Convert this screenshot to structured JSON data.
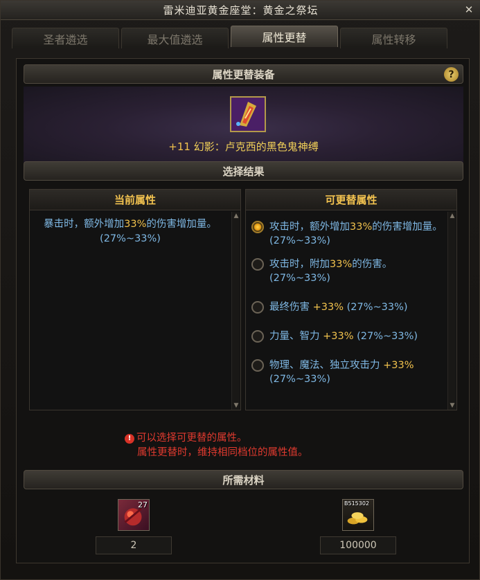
{
  "window": {
    "title": "雷米迪亚黄金座堂：黄金之祭坛",
    "close_glyph": "✕"
  },
  "tabs": [
    {
      "label": "圣者遴选"
    },
    {
      "label": "最大值遴选"
    },
    {
      "label": "属性更替"
    },
    {
      "label": "属性转移"
    }
  ],
  "equip_section": {
    "header": "属性更替装备",
    "help_glyph": "?",
    "item_plus": "+11",
    "item_name": "幻影：卢克西的黑色鬼神缚"
  },
  "result_section": {
    "header": "选择结果",
    "current": {
      "head": "当前属性",
      "text_before": "暴击时，额外增加",
      "text_num": "33%",
      "text_after": "的伤害增加量。(27%~33%)"
    },
    "options_head": "可更替属性",
    "options": [
      {
        "before": "攻击时，额外增加",
        "num": "33%",
        "after": "的伤害增加量。(27%~33%)",
        "checked": true
      },
      {
        "before": "攻击时，附加",
        "num": "33%",
        "after": "的伤害。(27%~33%)",
        "checked": false
      },
      {
        "before": "最终伤害 ",
        "num": "+33%",
        "after": " (27%~33%)",
        "checked": false
      },
      {
        "before": "力量、智力 ",
        "num": "+33%",
        "after": " (27%~33%)",
        "checked": false
      },
      {
        "before": "物理、魔法、独立攻击力 ",
        "num": "+33%",
        "after": " (27%~33%)",
        "checked": false
      }
    ]
  },
  "notice": {
    "icon_glyph": "!",
    "line1": "可以选择可更替的属性。",
    "line2": "属性更替时，维持相同档位的属性值。"
  },
  "materials_section": {
    "header": "所需材料",
    "items": [
      {
        "count_badge": "27",
        "quantity": "2"
      },
      {
        "count_badge": "B515302",
        "quantity": "100000"
      }
    ]
  },
  "colors": {
    "accent_gold": "#f1c24d",
    "attr_blue": "#7fb8e4",
    "warning_red": "#e03a2f"
  }
}
